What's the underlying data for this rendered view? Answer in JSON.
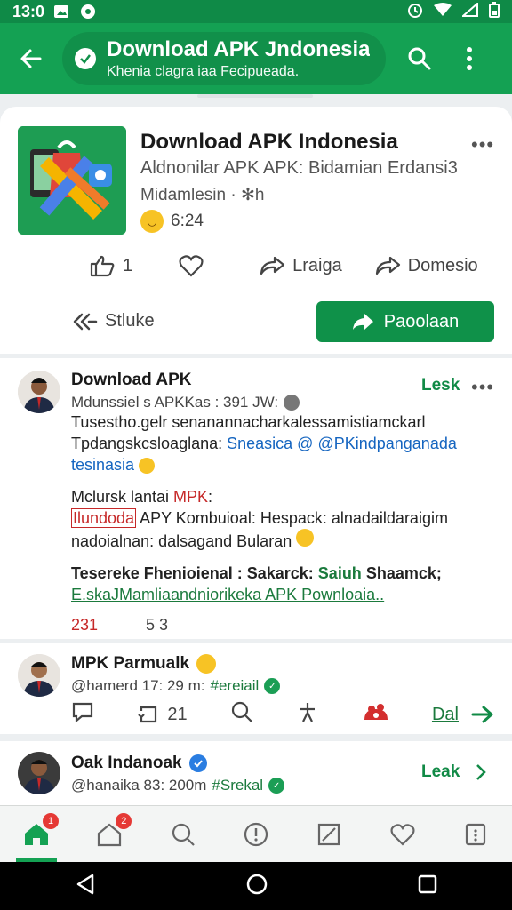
{
  "status": {
    "time": "13:0"
  },
  "appbar": {
    "title": "Download APK Jndonesia",
    "subtitle": "Khenia clagra iaa Fecipueada."
  },
  "app": {
    "name": "Download APK Indonesia",
    "subtitle": "Aldnonilar APK APK: Bidamian Erdansi3",
    "meta": "Midamlesin · ✻h",
    "rating": "6:24",
    "like_count": "1",
    "action_share_1": "Lraiga",
    "action_share_2": "Domesio",
    "secondary_action": "Stluke",
    "primary_action": "Paoolaan"
  },
  "posts": [
    {
      "author": "Download APK",
      "handle": "Mdunssiel s APKKas : 391 JW:",
      "follow": "Lesk",
      "p1_line1": "Tusestho.gelr senanannacharkalessamistiamckarl",
      "p1_line2": "Tpdangskcsloaglana: ",
      "p1_link": "Sneasica @ @PKindpanganada",
      "p1_link2": "tesinasia",
      "p2_head": "Mclursk lantai ",
      "p2_head_red": "MPK",
      "p2_head_end": ":",
      "p2_red": "Ilundoda",
      "p2_line1_rest": " APY Kombuioal: Hespack: alnadaildaraigim",
      "p2_line2": "nadoialnan: dalsagand Bularan",
      "p3_bold": "Tesereke Fhenioienal : Sakarck: ",
      "p3_green1": "Saiuh",
      "p3_bold2": " Shaamck;",
      "p3_line2": "E.skaJMamliaandniorikeka APK Pownloaia..",
      "stat1": "231",
      "stat2": "5 3"
    },
    {
      "author": "MPK Parmualk",
      "handle": "@hamerd 17: 29 m:",
      "hashtag": "#ereiail",
      "retweets": "21",
      "link_label": "Dal"
    },
    {
      "author": "Oak Indanoak",
      "handle": "@hanaika 83: 200m",
      "hashtag": "#Srekal",
      "follow": "Leak"
    }
  ],
  "nav": {
    "badge_home": "1",
    "badge_post": "2"
  },
  "colors": {
    "primary": "#14a153",
    "primary_dark": "#0f8a47",
    "accent_red": "#e53935",
    "link": "#1565c0"
  }
}
